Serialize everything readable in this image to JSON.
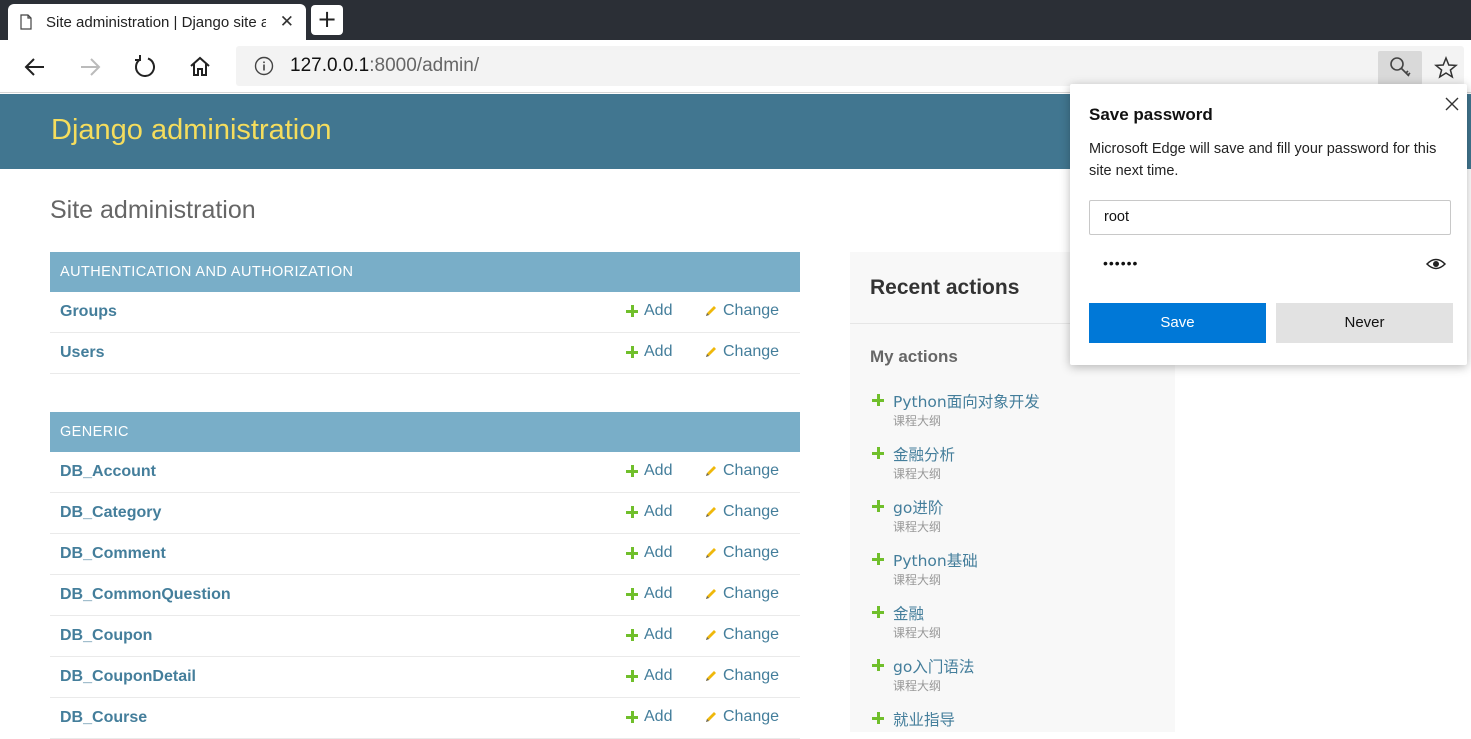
{
  "browser": {
    "tab_title": "Site administration | Django site admin",
    "tab_close": "✕",
    "new_tab": "+",
    "url_host": "127.0.0.1",
    "url_rest": ":8000/admin/"
  },
  "django": {
    "brand": "Django administration",
    "page_title": "Site administration",
    "add_label": "Add",
    "change_label": "Change",
    "modules": [
      {
        "caption": "AUTHENTICATION AND AUTHORIZATION",
        "models": [
          "Groups",
          "Users"
        ]
      },
      {
        "caption": "GENERIC",
        "models": [
          "DB_Account",
          "DB_Category",
          "DB_Comment",
          "DB_CommonQuestion",
          "DB_Coupon",
          "DB_CouponDetail",
          "DB_Course"
        ]
      }
    ]
  },
  "recent": {
    "title": "Recent actions",
    "my_actions": "My actions",
    "items": [
      {
        "name": "Python面向对象开发",
        "type": "课程大纲"
      },
      {
        "name": "金融分析",
        "type": "课程大纲"
      },
      {
        "name": "go进阶",
        "type": "课程大纲"
      },
      {
        "name": "Python基础",
        "type": "课程大纲"
      },
      {
        "name": "金融",
        "type": "课程大纲"
      },
      {
        "name": "go入门语法",
        "type": "课程大纲"
      },
      {
        "name": "就业指导",
        "type": ""
      }
    ]
  },
  "popup": {
    "title": "Save password",
    "description": "Microsoft Edge will save and fill your password for this site next time.",
    "username": "root",
    "password_mask": "••••••",
    "save_label": "Save",
    "never_label": "Never"
  },
  "colors": {
    "header_bg": "#417690",
    "brand_text": "#f5dd5d",
    "module_caption_bg": "#79aec8",
    "link": "#447e9b",
    "add_plus": "#70bf2b",
    "save_button": "#0078d7"
  }
}
